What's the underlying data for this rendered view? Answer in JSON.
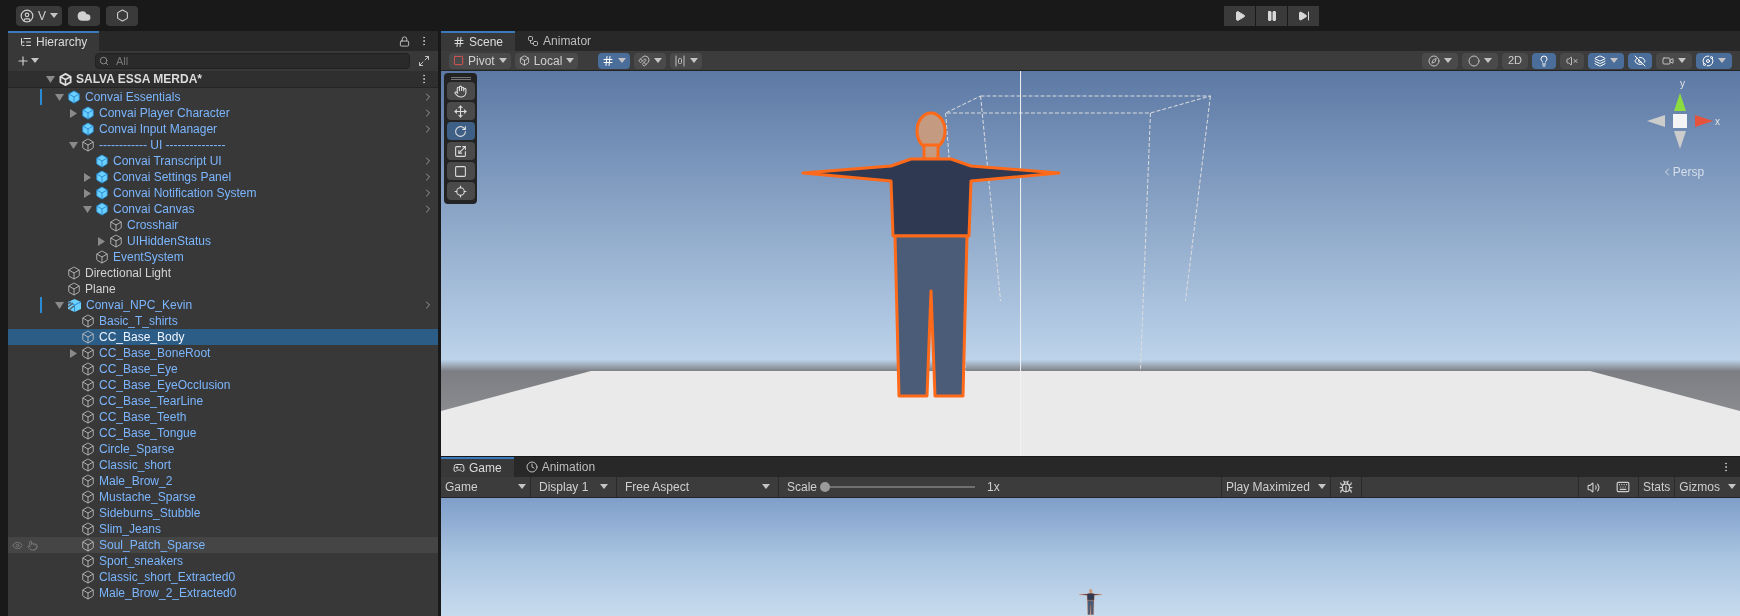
{
  "top_bar": {
    "account": {
      "label": "V"
    },
    "play_controls": [
      {
        "kind": "play",
        "selected": false
      },
      {
        "kind": "pause",
        "selected": false
      },
      {
        "kind": "step",
        "selected": false
      }
    ]
  },
  "hierarchy": {
    "tab": {
      "label": "Hierarchy",
      "selected": true
    },
    "search": {
      "placeholder": "All"
    },
    "scene": {
      "name": "SALVA ESSA MERDA*",
      "expanded": true
    },
    "items": [
      {
        "name": "Convai Essentials",
        "kind": "prefab",
        "blue": true,
        "overridden": true,
        "selected": false,
        "hovered": false,
        "expanded": true,
        "children": [
          {
            "name": "Convai Player Character",
            "kind": "prefab",
            "blue": true,
            "overridden": false,
            "selected": false,
            "hovered": false,
            "expanded": false
          },
          {
            "name": "Convai Input Manager",
            "kind": "prefab",
            "blue": true,
            "overridden": false,
            "selected": false,
            "hovered": false
          },
          {
            "name": "------------ UI ---------------",
            "kind": "object",
            "blue": true,
            "overridden": false,
            "selected": false,
            "hovered": false,
            "expanded": true,
            "children": [
              {
                "name": "Convai Transcript UI",
                "kind": "prefab",
                "blue": true,
                "overridden": false,
                "selected": false,
                "hovered": false
              },
              {
                "name": "Convai Settings Panel",
                "kind": "prefab",
                "blue": true,
                "overridden": false,
                "selected": false,
                "hovered": false,
                "expanded": false
              },
              {
                "name": "Convai Notification System",
                "kind": "prefab",
                "blue": true,
                "overridden": false,
                "selected": false,
                "hovered": false,
                "expanded": false
              },
              {
                "name": "Convai Canvas",
                "kind": "prefab",
                "blue": true,
                "overridden": false,
                "selected": false,
                "hovered": false,
                "expanded": true,
                "children": [
                  {
                    "name": "Crosshair",
                    "kind": "object",
                    "blue": true,
                    "overridden": false,
                    "selected": false,
                    "hovered": false
                  },
                  {
                    "name": "UIHiddenStatus",
                    "kind": "object",
                    "blue": true,
                    "overridden": false,
                    "selected": false,
                    "hovered": false,
                    "expanded": false
                  }
                ]
              },
              {
                "name": "EventSystem",
                "kind": "object",
                "blue": true,
                "overridden": false,
                "selected": false,
                "hovered": false
              }
            ]
          }
        ]
      },
      {
        "name": "Directional Light",
        "kind": "object",
        "blue": false,
        "overridden": false,
        "selected": false,
        "hovered": false
      },
      {
        "name": "Plane",
        "kind": "object",
        "blue": false,
        "overridden": false,
        "selected": false,
        "hovered": false
      },
      {
        "name": "Convai_NPC_Kevin",
        "kind": "variant",
        "blue": true,
        "overridden": true,
        "selected": false,
        "hovered": false,
        "expanded": true,
        "children": [
          {
            "name": "Basic_T_shirts",
            "kind": "object",
            "blue": true,
            "overridden": false,
            "selected": false,
            "hovered": false
          },
          {
            "name": "CC_Base_Body",
            "kind": "object",
            "blue": true,
            "overridden": false,
            "selected": true,
            "hovered": false
          },
          {
            "name": "CC_Base_BoneRoot",
            "kind": "object",
            "blue": true,
            "overridden": false,
            "selected": false,
            "hovered": false,
            "expanded": false
          },
          {
            "name": "CC_Base_Eye",
            "kind": "object",
            "blue": true,
            "overridden": false,
            "selected": false,
            "hovered": false
          },
          {
            "name": "CC_Base_EyeOcclusion",
            "kind": "object",
            "blue": true,
            "overridden": false,
            "selected": false,
            "hovered": false
          },
          {
            "name": "CC_Base_TearLine",
            "kind": "object",
            "blue": true,
            "overridden": false,
            "selected": false,
            "hovered": false
          },
          {
            "name": "CC_Base_Teeth",
            "kind": "object",
            "blue": true,
            "overridden": false,
            "selected": false,
            "hovered": false
          },
          {
            "name": "CC_Base_Tongue",
            "kind": "object",
            "blue": true,
            "overridden": false,
            "selected": false,
            "hovered": false
          },
          {
            "name": "Circle_Sparse",
            "kind": "object",
            "blue": true,
            "overridden": false,
            "selected": false,
            "hovered": false
          },
          {
            "name": "Classic_short",
            "kind": "object",
            "blue": true,
            "overridden": false,
            "selected": false,
            "hovered": false
          },
          {
            "name": "Male_Brow_2",
            "kind": "object",
            "blue": true,
            "overridden": false,
            "selected": false,
            "hovered": false
          },
          {
            "name": "Mustache_Sparse",
            "kind": "object",
            "blue": true,
            "overridden": false,
            "selected": false,
            "hovered": false
          },
          {
            "name": "Sideburns_Stubble",
            "kind": "object",
            "blue": true,
            "overridden": false,
            "selected": false,
            "hovered": false
          },
          {
            "name": "Slim_Jeans",
            "kind": "object",
            "blue": true,
            "overridden": false,
            "selected": false,
            "hovered": false
          },
          {
            "name": "Soul_Patch_Sparse",
            "kind": "object",
            "blue": true,
            "overridden": false,
            "selected": false,
            "hovered": true
          },
          {
            "name": "Sport_sneakers",
            "kind": "object",
            "blue": true,
            "overridden": false,
            "selected": false,
            "hovered": false
          },
          {
            "name": "Classic_short_Extracted0",
            "kind": "object",
            "blue": true,
            "overridden": false,
            "selected": false,
            "hovered": false
          },
          {
            "name": "Male_Brow_2_Extracted0",
            "kind": "object",
            "blue": true,
            "overridden": false,
            "selected": false,
            "hovered": false
          }
        ]
      }
    ]
  },
  "scene_view": {
    "tabs": [
      {
        "label": "Scene",
        "kind": "scene",
        "selected": true
      },
      {
        "label": "Animator",
        "kind": "animator",
        "selected": false
      }
    ],
    "pivot": {
      "label": "Pivot"
    },
    "space": {
      "label": "Local"
    },
    "snap_tools": [
      {
        "kind": "grid_snap",
        "on": true
      },
      {
        "kind": "increment_snap",
        "on": false
      },
      {
        "kind": "grid_visibility",
        "on": false
      }
    ],
    "view_tools": [
      {
        "kind": "orientation",
        "on": false
      },
      {
        "kind": "shading",
        "on": false
      },
      {
        "kind": "mode2d",
        "label": "2D",
        "on": false
      },
      {
        "kind": "lighting",
        "on": true
      },
      {
        "kind": "audio",
        "on": false
      },
      {
        "kind": "effects",
        "on": true
      },
      {
        "kind": "visibility",
        "on": true
      },
      {
        "kind": "camera",
        "on": false
      },
      {
        "kind": "gizmos",
        "on": true
      }
    ],
    "tools": [
      {
        "kind": "hand",
        "selected": false
      },
      {
        "kind": "move",
        "selected": false
      },
      {
        "kind": "rotate",
        "selected": true
      },
      {
        "kind": "scale",
        "selected": false
      },
      {
        "kind": "rect",
        "selected": false
      },
      {
        "kind": "transform",
        "selected": false
      }
    ],
    "gizmo": {
      "axis_y": "y",
      "axis_x": "x",
      "projection": "Persp"
    }
  },
  "game_view": {
    "tabs": [
      {
        "label": "Game",
        "kind": "game",
        "selected": true
      },
      {
        "label": "Animation",
        "kind": "animation",
        "selected": false
      }
    ],
    "mode": "Game",
    "display": "Display 1",
    "aspect": "Free Aspect",
    "scale": {
      "label": "Scale",
      "level": 0,
      "reading": "1x"
    },
    "play_mode": "Play Maximized",
    "stats": "Stats",
    "gizmos": "Gizmos"
  }
}
